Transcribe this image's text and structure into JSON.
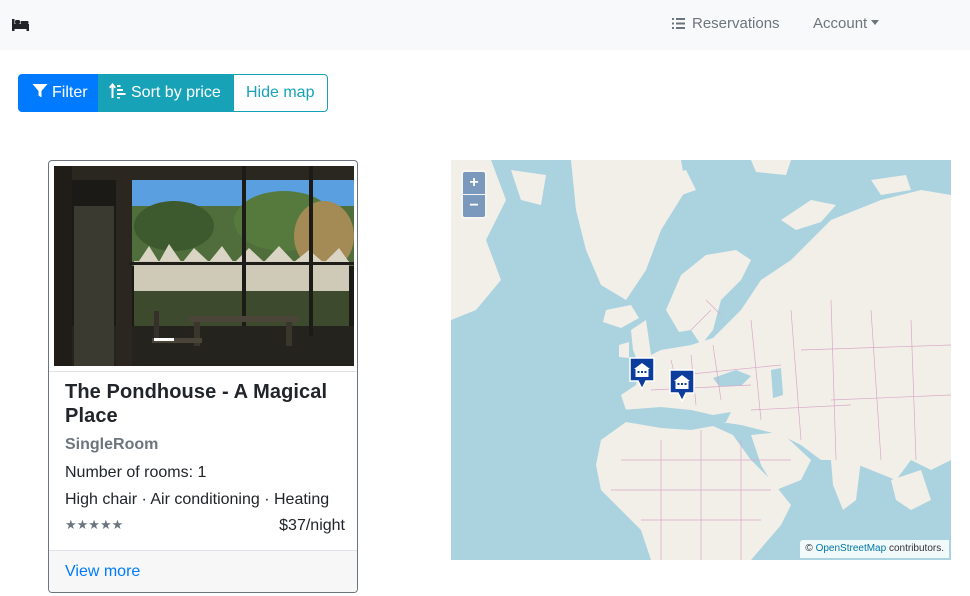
{
  "navbar": {
    "brand_icon": "bed-icon",
    "reservations_label": "Reservations",
    "account_label": "Account"
  },
  "toolbar": {
    "filter_label": "Filter",
    "sort_label": "Sort by price",
    "map_label": "Hide map"
  },
  "listing": {
    "title": "The Pondhouse - A Magical Place",
    "room_type": "SingleRoom",
    "rooms_text": "Number of rooms: 1",
    "amenities": "High chair · Air conditioning · Heating",
    "stars": "★★★★★",
    "price": "$37/night",
    "view_more": "View more"
  },
  "map": {
    "zoom_in": "+",
    "zoom_out": "−",
    "attribution_prefix": "©",
    "attribution_link": "OpenStreetMap",
    "attribution_suffix": "contributors.",
    "markers": [
      "hotel-marker",
      "hotel-marker"
    ]
  },
  "colors": {
    "primary": "#007bff",
    "info": "#17a2b8",
    "secondary": "#6c757d",
    "water": "#aad3df",
    "land": "#f2efe9",
    "marker": "#0d3d9c"
  }
}
